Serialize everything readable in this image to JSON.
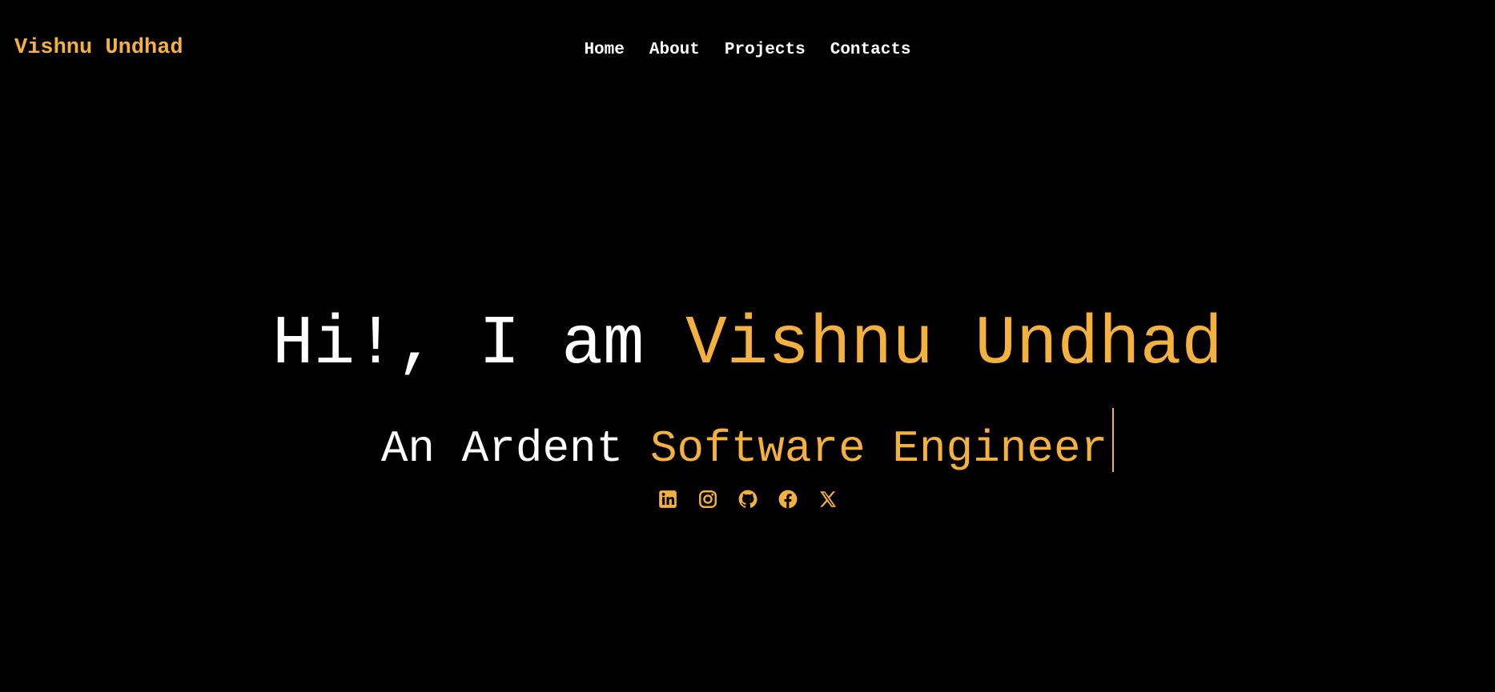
{
  "brand": {
    "name": "Vishnu Undhad"
  },
  "nav": {
    "items": [
      "Home",
      "About",
      "Projects",
      "Contacts"
    ]
  },
  "hero": {
    "greeting": "Hi!, I am ",
    "name": "Vishnu Undhad",
    "tagline_prefix": "An Ardent ",
    "tagline_role": "Software Engineer"
  },
  "social": {
    "icons": [
      "linkedin-icon",
      "instagram-icon",
      "github-icon",
      "facebook-icon",
      "x-icon"
    ]
  },
  "colors": {
    "background": "#000000",
    "accent": "#f4b13e",
    "text": "#ffffff"
  }
}
